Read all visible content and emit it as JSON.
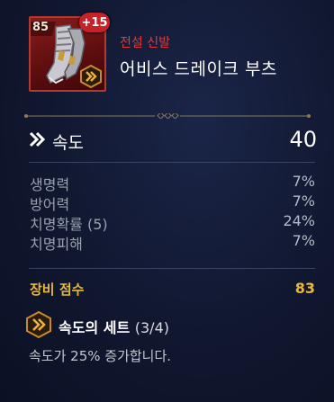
{
  "item": {
    "level": "85",
    "enhance": "+15",
    "grade": "전설 신발",
    "name": "어비스 드레이크 부츠"
  },
  "main_stat": {
    "icon": "speed-chevron-icon",
    "label": "속도",
    "value": "40"
  },
  "sub_stats": [
    {
      "name": "생명력",
      "value": "7%"
    },
    {
      "name": "방어력",
      "value": "7%"
    },
    {
      "name": "치명확률 (5)",
      "value": "24%"
    },
    {
      "name": "치명피해",
      "value": "7%"
    }
  ],
  "gear_score": {
    "label": "장비 점수",
    "value": "83"
  },
  "set": {
    "name": "속도의 세트",
    "count": "(3/4)",
    "description": "속도가 25% 증가합니다."
  },
  "colors": {
    "grade_red": "#e23a3a",
    "score_gold": "#e9b83a",
    "background": "#10172f"
  }
}
